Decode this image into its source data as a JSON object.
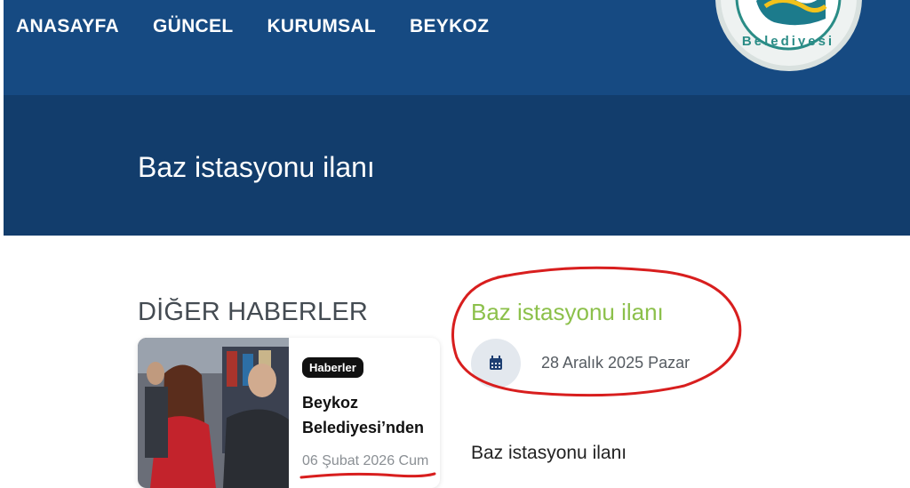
{
  "nav": {
    "items": [
      "ANASAYFA",
      "GÜNCEL",
      "KURUMSAL",
      "BEYKOZ"
    ]
  },
  "logo": {
    "text": "Belediyesi"
  },
  "page": {
    "title": "Baz istasyonu ilanı"
  },
  "other_news": {
    "heading": "DİĞER HABERLER",
    "card": {
      "badge": "Haberler",
      "title": "Beykoz Belediyesi’nden",
      "date": "06 Şubat 2026 Cum"
    }
  },
  "detail": {
    "title": "Baz istasyonu ilanı",
    "date": "28 Aralık 2025 Pazar",
    "body": "Baz istasyonu ilanı"
  },
  "colors": {
    "header": "#164a82",
    "banner": "#123d6c",
    "accent_green": "#8cc04b",
    "annotation_red": "#d81e1e"
  }
}
